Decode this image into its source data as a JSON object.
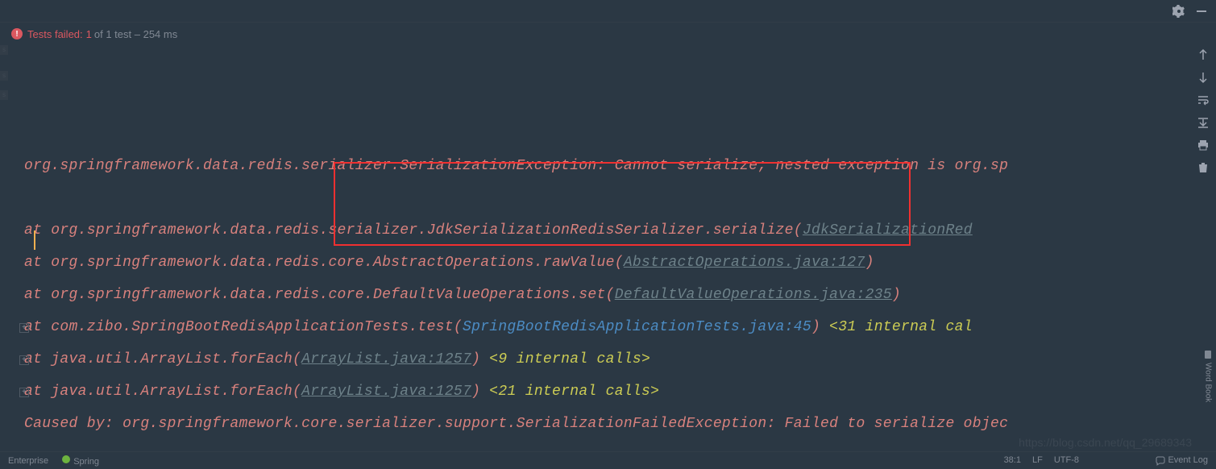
{
  "topbar": {},
  "test_status": {
    "label": "Tests failed:",
    "count": "1",
    "of_text": "of 1 test – 254 ms"
  },
  "console": {
    "exception_line": "org.springframework.data.redis.serializer.SerializationException: Cannot serialize; nested exception is org.sp",
    "stack": [
      {
        "prefix": "    at org.springframework.data.redis.serializer.JdkSerializationRedisSerializer.serialize(",
        "link": "JdkSerializationRed",
        "suffix": ""
      },
      {
        "prefix": "    at org.springframework.data.redis.core.AbstractOperations.rawValue(",
        "link": "AbstractOperations.java:127",
        "suffix": ")"
      },
      {
        "prefix": "    at org.springframework.data.redis.core.DefaultValueOperations.set(",
        "link": "DefaultValueOperations.java:235",
        "suffix": ")"
      },
      {
        "prefix": "    at com.zibo.SpringBootRedisApplicationTests.test(",
        "link_blue": "SpringBootRedisApplicationTests.java:45",
        "suffix": ")",
        "internal": " <31 internal cal"
      },
      {
        "prefix": "    at java.util.ArrayList.forEach(",
        "link": "ArrayList.java:1257",
        "suffix": ")",
        "internal": " <9 internal calls>"
      },
      {
        "prefix": "    at java.util.ArrayList.forEach(",
        "link": "ArrayList.java:1257",
        "suffix": ")",
        "internal": " <21 internal calls>"
      }
    ],
    "caused_by": "Caused by: org.springframework.core.serializer.support.SerializationFailedException: Failed to serialize objec"
  },
  "bottom": {
    "enterprise": "Enterprise",
    "spring": "Spring",
    "event_log": "Event Log",
    "pos": "38:1",
    "line_sep": "LF",
    "encoding": "UTF-8",
    "watermark_text": "https://blog.csdn.net/qq_29689343"
  },
  "sidebar": {
    "word_book": "Word Book"
  }
}
